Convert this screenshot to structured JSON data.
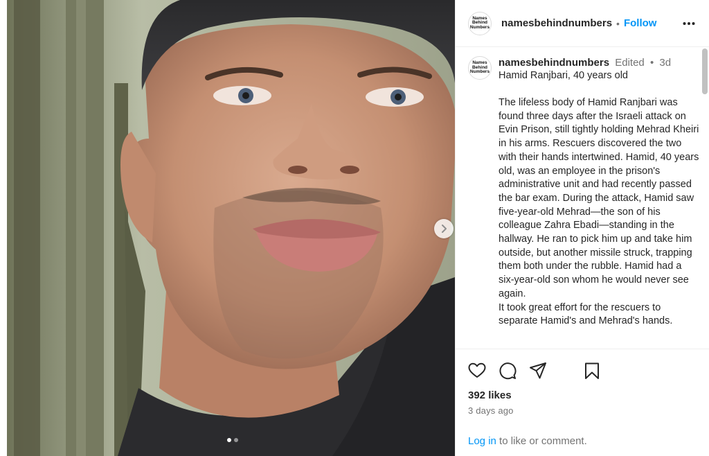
{
  "post": {
    "username": "namesbehindnumbers",
    "follow_label": "Follow",
    "separator": "•",
    "avatar_text": [
      "Names",
      "Behind",
      "Numbers"
    ],
    "edited_label": "Edited",
    "age": "3d",
    "caption_title": "Hamid Ranjbari, 40 years old",
    "caption_text": "The lifeless body of Hamid Ranjbari was found three days after the Israeli attack on Evin Prison, still tightly holding Mehrad Kheiri in his arms. Rescuers discovered the two with their hands intertwined. Hamid, 40 years old, was an employee in the prison's administrative unit and had recently passed the bar exam. During the attack, Hamid saw five-year-old Mehrad—the son of his colleague Zahra Ebadi—standing in the hallway. He ran to pick him up and take him outside, but another missile struck, trapping them both under the rubble. Hamid had a six-year-old son whom he would never see again.\n It took great effort for the rescuers to separate Hamid's and Mehrad's hands.",
    "likes": "392 likes",
    "timestamp": "3 days ago",
    "login_link": "Log in",
    "login_rest": " to like or comment."
  },
  "carousel": {
    "current_slide": 1,
    "total_slides": 2
  },
  "icons": {
    "more": "more-options-icon",
    "next": "chevron-right-icon",
    "like": "heart-icon",
    "comment": "comment-icon",
    "share": "share-icon",
    "save": "bookmark-icon"
  },
  "colors": {
    "link": "#0095f6",
    "muted": "#737373",
    "text": "#262626"
  }
}
